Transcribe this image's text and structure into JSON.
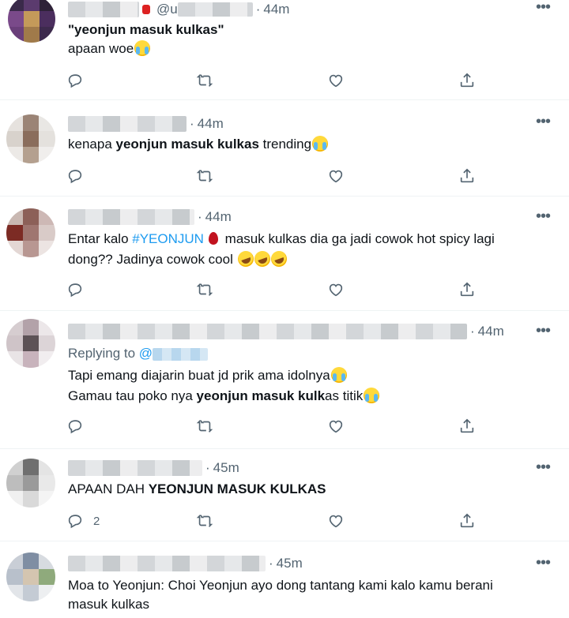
{
  "tweets": [
    {
      "time": "44m",
      "handle_prefix": "@u",
      "lines": [
        {
          "segments": [
            {
              "text": "\"yeonjun masuk kulkas\"",
              "bold": true
            }
          ]
        },
        {
          "segments": [
            {
              "text": "apaan woe"
            }
          ],
          "emoji": "loudly-crying-face"
        }
      ],
      "reply_count": ""
    },
    {
      "time": "44m",
      "lines": [
        {
          "segments": [
            {
              "text": "kenapa "
            },
            {
              "text": "yeonjun masuk kulkas",
              "bold": true
            },
            {
              "text": " trending"
            }
          ],
          "emoji": "loudly-crying-face"
        }
      ],
      "reply_count": ""
    },
    {
      "time": "44m",
      "lines": [
        {
          "segments": [
            {
              "text": "Entar kalo "
            },
            {
              "text": "#YEONJUN",
              "hashtag": true
            },
            {
              "text": " masuk kulkas dia ga jadi cowok hot spicy lagi"
            }
          ],
          "emoji": "drop-of-blood"
        },
        {
          "segments": [
            {
              "text": "dong?? Jadinya cowok cool "
            }
          ],
          "emoji": "rolling-on-floor-laughing x3"
        }
      ],
      "reply_count": ""
    },
    {
      "time": "44m",
      "replying_to": "Replying to",
      "replying_at": "@",
      "lines": [
        {
          "segments": [
            {
              "text": "Tapi emang diajarin buat jd prik ama idolnya"
            }
          ],
          "emoji": "loudly-crying-face"
        },
        {
          "segments": [
            {
              "text": "Gamau tau poko nya "
            },
            {
              "text": "yeonjun masuk kulk",
              "bold": true
            },
            {
              "text": "as titik"
            }
          ],
          "emoji": "loudly-crying-face"
        }
      ],
      "reply_count": ""
    },
    {
      "time": "45m",
      "lines": [
        {
          "segments": [
            {
              "text": "APAAN DAH "
            },
            {
              "text": "YEONJUN MASUK KULKAS",
              "bold": true
            }
          ]
        }
      ],
      "reply_count": "2"
    },
    {
      "time": "45m",
      "lines": [
        {
          "segments": [
            {
              "text": "Moa to Yeonjun: Choi Yeonjun ayo dong tantang kami kalo kamu berani"
            }
          ]
        },
        {
          "segments": [
            {
              "text": "masuk kulkas"
            }
          ]
        }
      ],
      "reply_count": ""
    }
  ],
  "icons": {
    "reply": "reply-icon",
    "retweet": "retweet-icon",
    "like": "like-icon",
    "share": "share-icon",
    "more": "more-icon"
  },
  "colors": {
    "text": "#0f1419",
    "secondary": "#536471",
    "link": "#1d9bf0",
    "divider": "#eff3f4"
  }
}
